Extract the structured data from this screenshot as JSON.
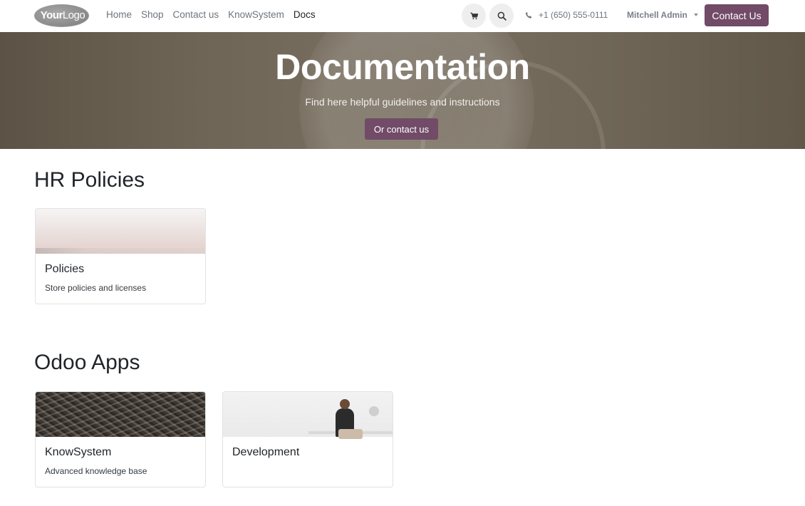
{
  "navbar": {
    "logo": {
      "bold": "Your",
      "light": "Logo"
    },
    "links": [
      {
        "label": "Home",
        "active": false
      },
      {
        "label": "Shop",
        "active": false
      },
      {
        "label": "Contact us",
        "active": false
      },
      {
        "label": "KnowSystem",
        "active": false
      },
      {
        "label": "Docs",
        "active": true
      }
    ],
    "cart_icon": "cart-icon",
    "search_icon": "search-icon",
    "phone": {
      "icon": "phone-icon",
      "number": "+1 (650) 555-0111"
    },
    "user": {
      "name": "Mitchell Admin",
      "icon": "caret-down-icon"
    },
    "cta_label": "Contact Us"
  },
  "hero": {
    "title": "Documentation",
    "subtitle": "Find here helpful guidelines and instructions",
    "button_label": "Or contact us"
  },
  "sections": [
    {
      "title": "HR Policies",
      "cards": [
        {
          "title": "Policies",
          "description": "Store policies and licenses"
        }
      ]
    },
    {
      "title": "Odoo Apps",
      "cards": [
        {
          "title": "KnowSystem",
          "description": "Advanced knowledge base"
        },
        {
          "title": "Development",
          "description": ""
        }
      ]
    }
  ],
  "colors": {
    "primary": "#714b67",
    "hero_bg": "#6f6556",
    "nav_text": "#6c757d"
  }
}
